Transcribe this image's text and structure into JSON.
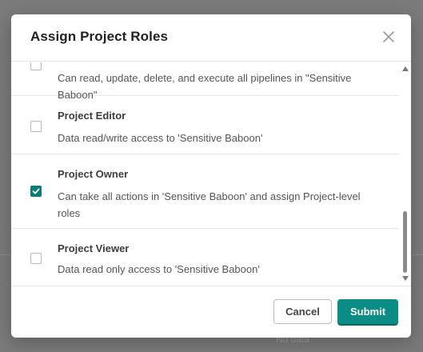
{
  "modal": {
    "title": "Assign Project Roles",
    "close_icon": "close-icon"
  },
  "roles": [
    {
      "name": "",
      "description": "Can read, update, delete, and execute all pipelines in \"Sensitive Baboon\"",
      "checked": false
    },
    {
      "name": "Project Editor",
      "description": "Data read/write access to 'Sensitive Baboon'",
      "checked": false
    },
    {
      "name": "Project Owner",
      "description": "Can take all actions in 'Sensitive Baboon' and assign Project-level roles",
      "checked": true
    },
    {
      "name": "Project Viewer",
      "description": "Data read only access to 'Sensitive Baboon'",
      "checked": false
    }
  ],
  "footer": {
    "cancel_label": "Cancel",
    "submit_label": "Submit"
  },
  "background": {
    "no_data_text": "No data"
  },
  "colors": {
    "accent": "#0b8c84",
    "checkbox_checked": "#0b7c75"
  }
}
